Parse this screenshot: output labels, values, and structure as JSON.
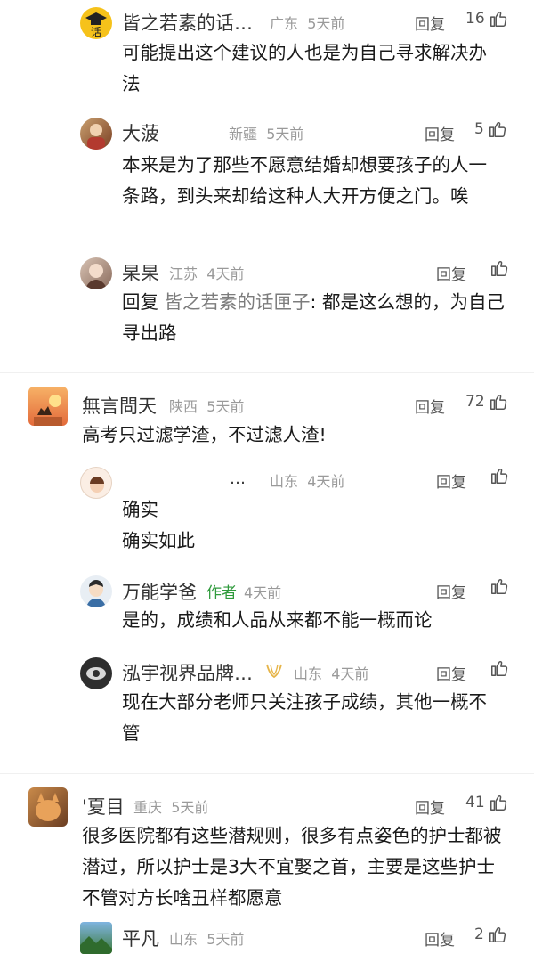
{
  "reply_label": "回复",
  "author_tag": "作者",
  "comments": [
    {
      "name": "皆之若素的话…",
      "region": "广东",
      "time": "5天前",
      "likes": "16",
      "text": "可能提出这个建议的人也是为自己寻求解决办法"
    },
    {
      "name": "大菠",
      "region": "新疆",
      "time": "5天前",
      "likes": "5",
      "text": "本来是为了那些不愿意结婚却想要孩子的人一条路，到头来却给这种人大开方便之门。唉"
    },
    {
      "name": "杲杲",
      "region": "江苏",
      "time": "4天前",
      "likes": "",
      "reply_prefix": "回复",
      "reply_to": "皆之若素的话匣子",
      "text": ": 都是这么想的，为自己寻出路"
    },
    {
      "name": "無言問天",
      "region": "陕西",
      "time": "5天前",
      "likes": "72",
      "text": "高考只过滤学渣，不过滤人渣!"
    },
    {
      "name": "…",
      "region": "山东",
      "time": "4天前",
      "likes": "",
      "text_lines": [
        "确实",
        "确实如此"
      ]
    },
    {
      "name": "万能学爸",
      "region": "",
      "time": "4天前",
      "likes": "",
      "text": "是的，成绩和人品从来都不能一概而论"
    },
    {
      "name": "泓宇视界品牌…",
      "region": "山东",
      "time": "4天前",
      "likes": "",
      "text": "现在大部分老师只关注孩子成绩，其他一概不管"
    },
    {
      "name": "'夏目",
      "region": "重庆",
      "time": "5天前",
      "likes": "41",
      "text": "很多医院都有这些潜规则，很多有点姿色的护士都被潜过，所以护士是3大不宜娶之首，主要是这些护士不管对方长啥丑样都愿意"
    },
    {
      "name": "平凡",
      "region": "山东",
      "time": "5天前",
      "likes": "2",
      "text": ""
    }
  ]
}
